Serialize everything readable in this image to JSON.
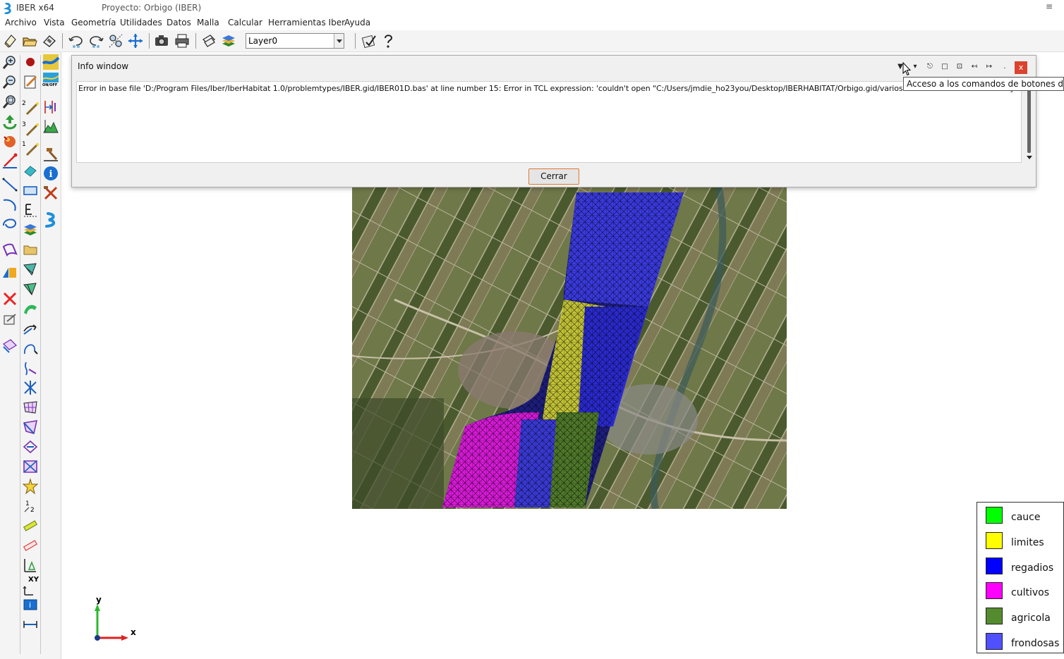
{
  "titlebar": {
    "app_name": "IBER x64",
    "project": "Proyecto: Orbigo (IBER)",
    "window_menu_glyph": "≡"
  },
  "menu": {
    "items": [
      "Archivo",
      "Vista",
      "Geometría",
      "Utilidades",
      "Datos",
      "Malla",
      "Calcular",
      "Herramientas Iber",
      "Ayuda"
    ]
  },
  "toolbar": {
    "layer_value": "Layer0"
  },
  "info_window": {
    "title": "Info window",
    "message": "Error in base file 'D:/Program Files/Iber/IberHabitat 1.0/problemtypes/IBER.gid/IBER01D.bas' at line number 15: Error in TCL expression: 'couldn't open \"C:/Users/jmdie_ho23you/Desktop/IBERHABITAT/Orbigo.gid/varios.txt\": no such file or directory'",
    "close_button": "Cerrar",
    "close_glyph": "x"
  },
  "tooltip": {
    "text": "Acceso a los comandos de botones de títul"
  },
  "axis": {
    "x_label": "x",
    "y_label": "y"
  },
  "left_toolbar": {
    "labels": [
      "2",
      "3",
      "1"
    ],
    "xy_label": "XY",
    "onoff_label": "ON/OFF"
  },
  "legend": {
    "items": [
      {
        "label": "cauce",
        "color": "#00ff00"
      },
      {
        "label": "limites",
        "color": "#ffff00"
      },
      {
        "label": "regadios",
        "color": "#0000ff"
      },
      {
        "label": "cultivos",
        "color": "#ff00ff"
      },
      {
        "label": "agricola",
        "color": "#558b2f"
      },
      {
        "label": "frondosas",
        "color": "#5050ff"
      }
    ]
  },
  "colors": {
    "accent_orange": "#e07a2f",
    "close_red": "#d9432f"
  }
}
